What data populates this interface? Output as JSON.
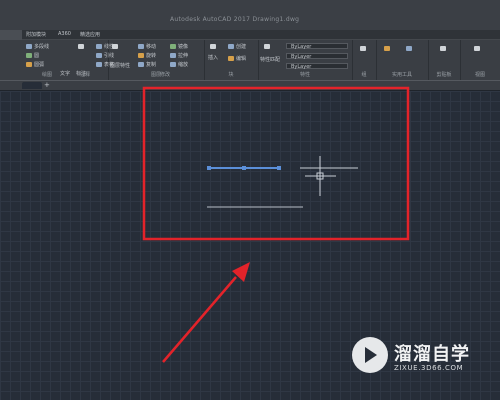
{
  "titlebar": {
    "tabs": [
      "附加模块",
      "A360",
      "精选应用"
    ]
  },
  "ribbon": {
    "draw_tools": [
      "多段线",
      "圆",
      "圆弧"
    ],
    "modify_tools": [
      "移动",
      "旋转",
      "复制",
      "镜像",
      "拉伸",
      "缩放"
    ],
    "annotation_tools": [
      "文字",
      "标注",
      "线性",
      "引线",
      "表格"
    ],
    "layer_tools": [
      "图层特性"
    ],
    "block_tools": [
      "插入",
      "创建",
      "编辑"
    ],
    "properties": {
      "label": "特性匹配",
      "layer_values": [
        "ByLayer",
        "ByLayer",
        "ByLayer"
      ]
    },
    "groups": [
      "绘图",
      "修改",
      "注释",
      "图层",
      "块",
      "特性",
      "组",
      "实用工具",
      "剪贴板",
      "视图"
    ]
  },
  "watermark": {
    "name": "溜溜自学",
    "url": "ZIXUE.3D66.COM"
  },
  "colors": {
    "canvas": "#262d38",
    "grid": "#2f3744",
    "selection": "#5b8fd8",
    "annotation": "#e3232a"
  },
  "icons": [
    "crosshair-cursor-icon",
    "grip-icon",
    "play-icon"
  ]
}
